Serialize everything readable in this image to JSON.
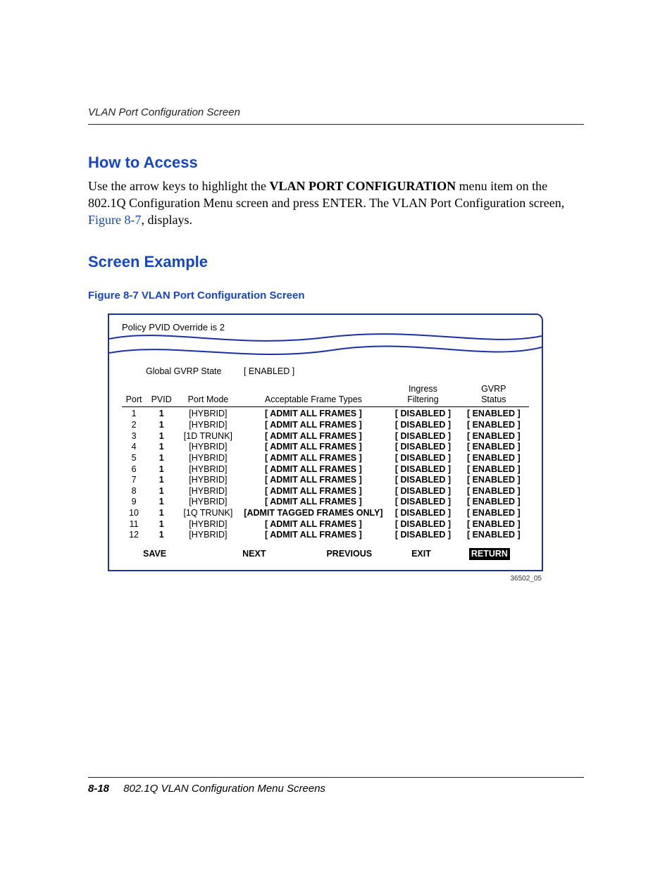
{
  "running_head": "VLAN Port Configuration Screen",
  "sections": {
    "how_to_access": {
      "title": "How to Access",
      "para_pre": "Use the arrow keys to highlight the ",
      "menu_item": "VLAN PORT CONFIGURATION",
      "para_mid": " menu item on the 802.1Q Configuration Menu screen and press ENTER. The VLAN Port Configuration screen, ",
      "figure_ref": "Figure 8-7",
      "para_post": ", displays."
    },
    "screen_example": {
      "title": "Screen Example",
      "figure_caption": "Figure 8-7   VLAN Port Configuration Screen"
    }
  },
  "terminal": {
    "banner": "Policy PVID Override is 2",
    "gvrp_label": "Global GVRP State",
    "gvrp_value": "[ ENABLED ]",
    "headers": {
      "port": "Port",
      "pvid": "PVID",
      "mode": "Port Mode",
      "frame": "Acceptable Frame Types",
      "ingress_l1": "Ingress",
      "ingress_l2": "Filtering",
      "gvrp_l1": "GVRP",
      "gvrp_l2": "Status"
    },
    "rows": [
      {
        "port": "1",
        "pvid": "1",
        "mode": "[HYBRID]",
        "frame": "[   ADMIT ALL FRAMES   ]",
        "ingress": "[  DISABLED  ]",
        "gvrp": "[  ENABLED  ]"
      },
      {
        "port": "2",
        "pvid": "1",
        "mode": "[HYBRID]",
        "frame": "[   ADMIT ALL FRAMES   ]",
        "ingress": "[  DISABLED  ]",
        "gvrp": "[  ENABLED  ]"
      },
      {
        "port": "3",
        "pvid": "1",
        "mode": "[1D TRUNK]",
        "frame": "[   ADMIT ALL FRAMES   ]",
        "ingress": "[  DISABLED  ]",
        "gvrp": "[  ENABLED  ]"
      },
      {
        "port": "4",
        "pvid": "1",
        "mode": "[HYBRID]",
        "frame": "[   ADMIT ALL FRAMES   ]",
        "ingress": "[  DISABLED  ]",
        "gvrp": "[  ENABLED  ]"
      },
      {
        "port": "5",
        "pvid": "1",
        "mode": "[HYBRID]",
        "frame": "[   ADMIT ALL FRAMES   ]",
        "ingress": "[  DISABLED  ]",
        "gvrp": "[  ENABLED  ]"
      },
      {
        "port": "6",
        "pvid": "1",
        "mode": "[HYBRID]",
        "frame": "[   ADMIT ALL FRAMES   ]",
        "ingress": "[  DISABLED  ]",
        "gvrp": "[  ENABLED  ]"
      },
      {
        "port": "7",
        "pvid": "1",
        "mode": "[HYBRID]",
        "frame": "[   ADMIT ALL FRAMES   ]",
        "ingress": "[  DISABLED  ]",
        "gvrp": "[  ENABLED  ]"
      },
      {
        "port": "8",
        "pvid": "1",
        "mode": "[HYBRID]",
        "frame": "[   ADMIT ALL FRAMES   ]",
        "ingress": "[  DISABLED  ]",
        "gvrp": "[  ENABLED  ]"
      },
      {
        "port": "9",
        "pvid": "1",
        "mode": "[HYBRID]",
        "frame": "[   ADMIT ALL FRAMES   ]",
        "ingress": "[  DISABLED  ]",
        "gvrp": "[  ENABLED  ]"
      },
      {
        "port": "10",
        "pvid": "1",
        "mode": "[1Q TRUNK]",
        "frame": "[ADMIT TAGGED FRAMES ONLY]",
        "ingress": "[  DISABLED  ]",
        "gvrp": "[  ENABLED  ]"
      },
      {
        "port": "11",
        "pvid": "1",
        "mode": "[HYBRID]",
        "frame": "[   ADMIT ALL FRAMES   ]",
        "ingress": "[  DISABLED  ]",
        "gvrp": "[  ENABLED  ]"
      },
      {
        "port": "12",
        "pvid": "1",
        "mode": "[HYBRID]",
        "frame": "[   ADMIT ALL FRAMES   ]",
        "ingress": "[  DISABLED  ]",
        "gvrp": "[  ENABLED  ]"
      }
    ],
    "menu": {
      "save": "SAVE",
      "next": "NEXT",
      "previous": "PREVIOUS",
      "exit": "EXIT",
      "return": "RETURN"
    },
    "figure_id": "36502_05"
  },
  "footer": {
    "page_num": "8-18",
    "title": "802.1Q VLAN Configuration Menu Screens"
  }
}
